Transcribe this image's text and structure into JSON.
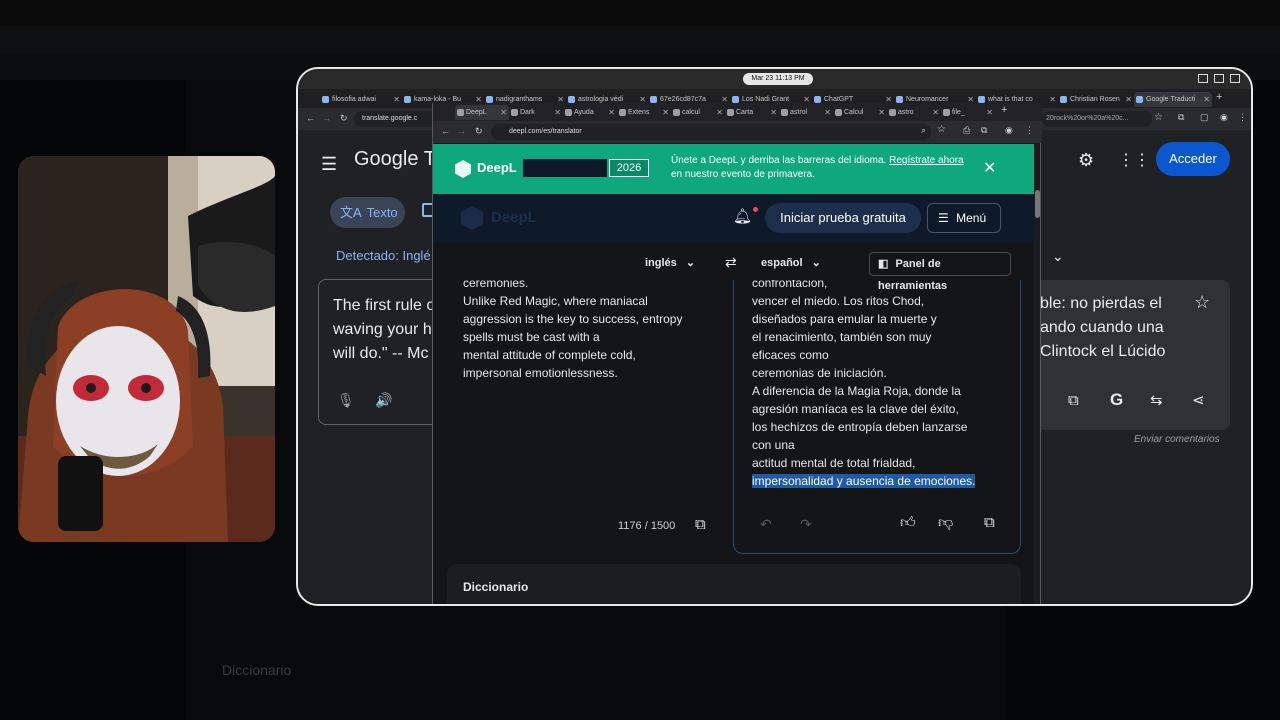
{
  "background": {
    "bottom_label": "Diccionario"
  },
  "clock": "Mar 23 11:13 PM",
  "outer_tabs": [
    {
      "label": "filosofia adwai"
    },
    {
      "label": "kama-loka - Bu"
    },
    {
      "label": "nadigranthams"
    },
    {
      "label": "astrologia védi"
    },
    {
      "label": "67e26cd87c7a"
    },
    {
      "label": "Los Nadi Grant"
    },
    {
      "label": "ChatGPT"
    },
    {
      "label": "Neuromancer"
    },
    {
      "label": "what is that co"
    },
    {
      "label": "Christian Rosen"
    },
    {
      "label": "Google Traducti"
    }
  ],
  "outer_address": "translate.google.c",
  "outer_address_tail": "20rock%20or%20a%20c...",
  "google_translate": {
    "logo": "Google Tr",
    "mode_tab": "Texto",
    "detected_label": "Detectado: Inglé",
    "source_text": [
      "The first rule o",
      "waving your ha",
      "will do.\" -- Mc"
    ],
    "target_text": [
      "ble: no pierdas el",
      "ando cuando una",
      "Clintock el Lúcido"
    ],
    "sign_in": "Acceder",
    "feedback": "Enviar comentarios"
  },
  "deepl_tabs": [
    {
      "label": "DeepL"
    },
    {
      "label": "Dark"
    },
    {
      "label": "Ayuda"
    },
    {
      "label": "Extens"
    },
    {
      "label": "calcul"
    },
    {
      "label": "Carta"
    },
    {
      "label": "astrol"
    },
    {
      "label": "Calcul"
    },
    {
      "label": "astro"
    },
    {
      "label": "file_"
    }
  ],
  "deepl_address": "deepl.com/es/translator",
  "deepl": {
    "banner_brand": "DeepL",
    "banner_year": "2026",
    "banner_text_1": "Únete a DeepL y derriba las barreras del idioma.",
    "banner_link": "Regístrate ahora",
    "banner_text_2": "en nuestro evento de primavera.",
    "logo": "DeepL",
    "trial_button": "Iniciar prueba gratuita",
    "menu_button": "Menú",
    "source_lang": "inglés",
    "target_lang": "español",
    "tools_panel": "Panel de herramientas",
    "source_lines": [
      "ceremonies.",
      "Unlike Red Magic, where maniacal",
      "aggression is the key to success, entropy",
      "spells must be cast with a",
      "mental attitude of complete cold,",
      "impersonal emotionlessness."
    ],
    "target_lines": [
      "confrontación,",
      "vencer el miedo. Los ritos Chod,",
      "diseñados para emular la muerte y",
      "el renacimiento, también son muy",
      "eficaces como",
      "ceremonias de iniciación.",
      "A diferencia de la Magia Roja, donde la",
      "agresión maníaca es la clave del éxito,",
      "los hechizos de entropía deben lanzarse",
      "con una",
      "actitud mental de total frialdad,"
    ],
    "target_selected": "impersonalidad y ausencia de emociones.",
    "char_count": "1176 / 1500",
    "dictionary": "Diccionario"
  }
}
